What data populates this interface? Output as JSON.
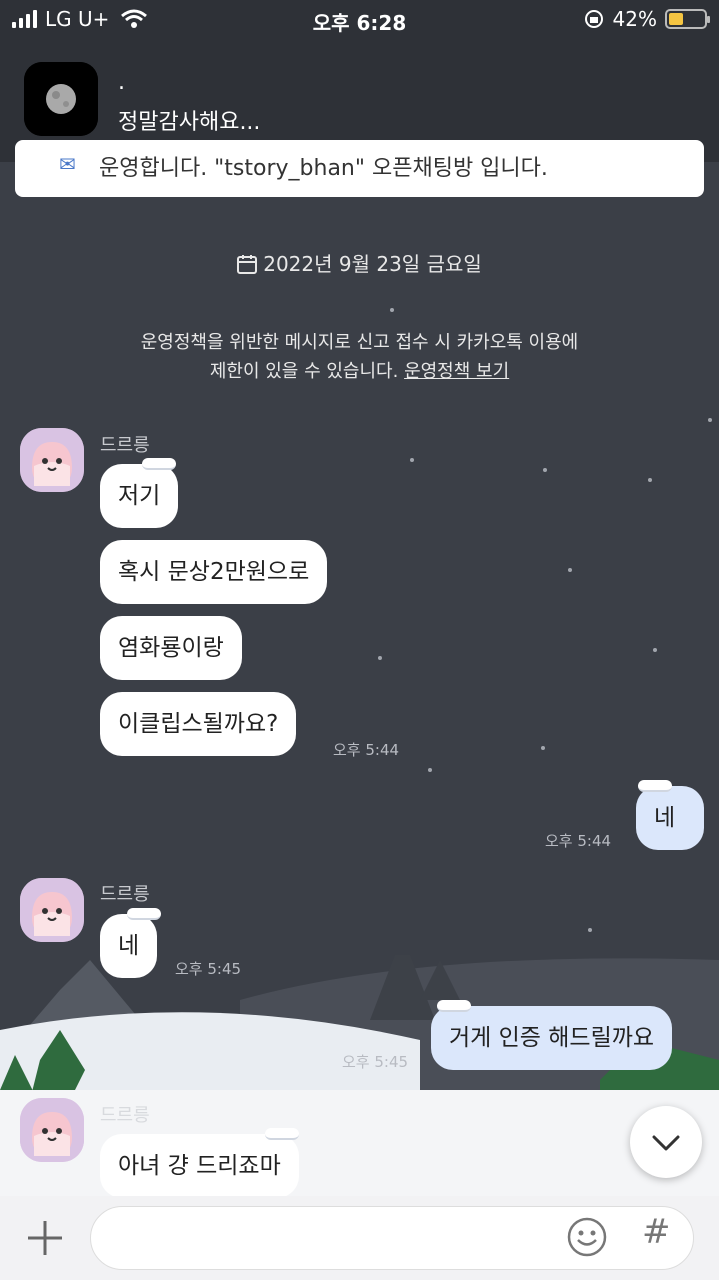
{
  "status_bar": {
    "carrier": "LG U+",
    "time": "오후 6:28",
    "battery": "42%",
    "battery_level": 0.42
  },
  "notification": {
    "sender": ".",
    "message": "정말감사해요..."
  },
  "notice": {
    "text": "운영합니다. \"tstory_bhan\" 오픈채팅방 입니다."
  },
  "chat": {
    "date": "2022년 9월 23일 금요일",
    "policy_text": "운영정책을 위반한 메시지로 신고 접수 시 카카오톡 이용에",
    "policy_text2": "제한이 있을 수 있습니다.",
    "policy_link": "운영정책 보기",
    "messages": [
      {
        "sender": "드르릉",
        "text": "저기"
      },
      {
        "text": "혹시 문상2만원으로"
      },
      {
        "text": "염화룡이랑"
      },
      {
        "text": "이클립스될까요?",
        "time": "오후 5:44"
      },
      {
        "mine": true,
        "text": "네",
        "time": "오후 5:44"
      },
      {
        "sender": "드르릉",
        "text": "네",
        "time": "오후 5:45"
      },
      {
        "mine": true,
        "text": "거게 인증 해드릴까요",
        "time": "오후 5:45"
      },
      {
        "sender": "드르릉",
        "text": "아녀 걍 드리죠마"
      }
    ]
  },
  "input": {
    "placeholder": ""
  },
  "icons": {
    "scroll_down": "chevron-down-icon",
    "plus": "plus-icon",
    "emoji": "emoji-icon",
    "hash": "hash-icon"
  }
}
